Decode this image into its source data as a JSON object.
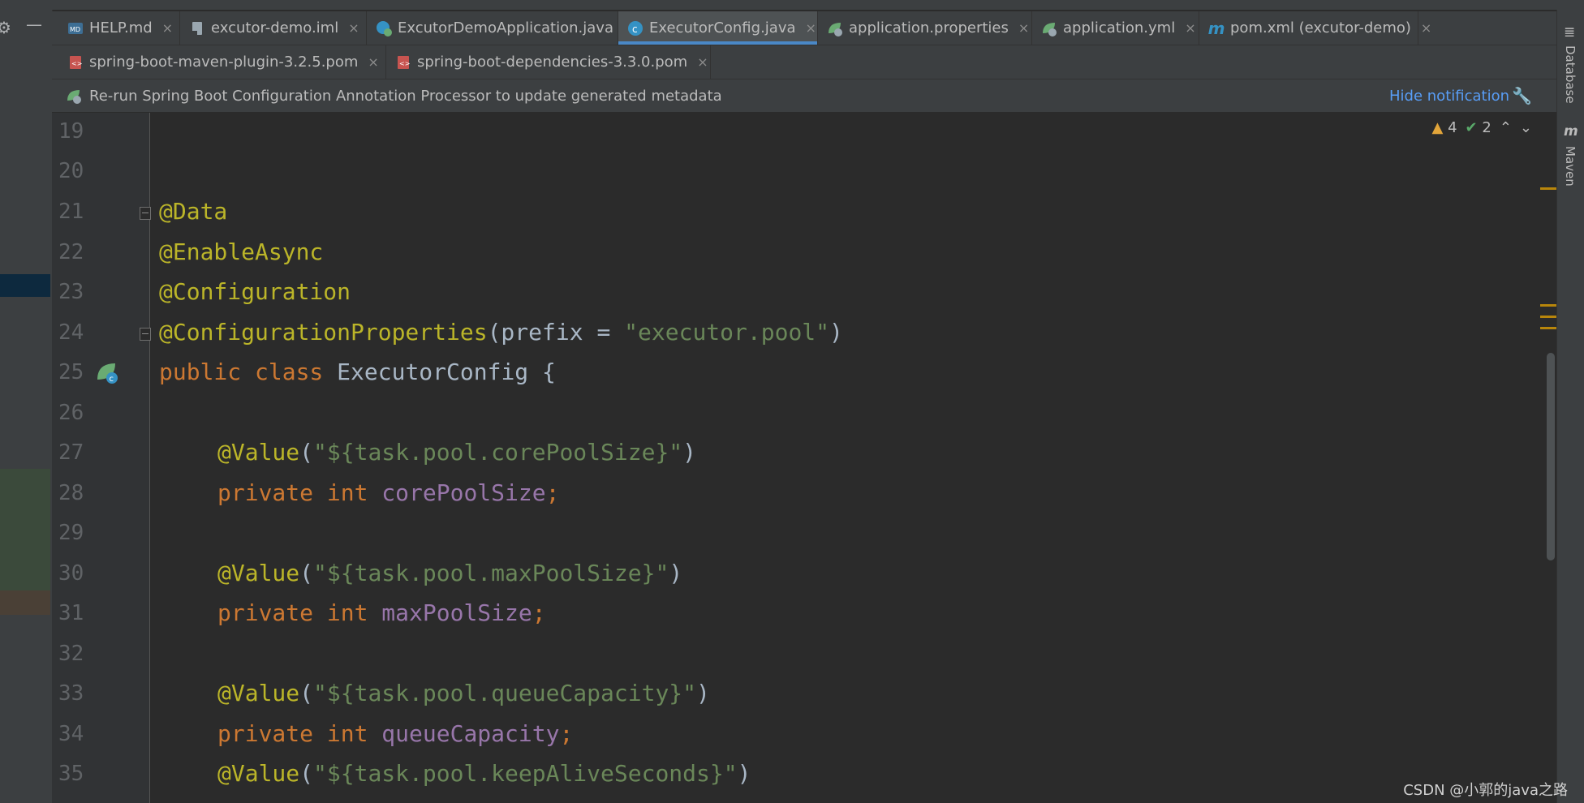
{
  "tabs_row1": [
    {
      "label": "HELP.md",
      "icon": "markdown-file-icon"
    },
    {
      "label": "excutor-demo.iml",
      "icon": "module-file-icon"
    },
    {
      "label": "ExcutorDemoApplication.java",
      "icon": "spring-boot-class-icon"
    },
    {
      "label": "ExecutorConfig.java",
      "icon": "java-class-icon",
      "active": true
    },
    {
      "label": "application.properties",
      "icon": "spring-properties-icon"
    },
    {
      "label": "application.yml",
      "icon": "spring-yaml-icon"
    },
    {
      "label": "pom.xml (excutor-demo)",
      "icon": "maven-icon"
    }
  ],
  "tabs_row2": [
    {
      "label": "spring-boot-maven-plugin-3.2.5.pom",
      "icon": "pom-file-icon"
    },
    {
      "label": "spring-boot-dependencies-3.3.0.pom",
      "icon": "pom-file-icon"
    }
  ],
  "tab_close_glyph": "×",
  "notification": {
    "text": "Re-run Spring Boot Configuration Annotation Processor to update generated metadata",
    "action": "Hide notification"
  },
  "inspection": {
    "warnings": "4",
    "weak_warnings": "2"
  },
  "right_toolbar": {
    "database": "Database",
    "maven": "Maven"
  },
  "line_numbers": [
    "19",
    "20",
    "21",
    "22",
    "23",
    "24",
    "25",
    "26",
    "27",
    "28",
    "29",
    "30",
    "31",
    "32",
    "33",
    "34",
    "35"
  ],
  "code": {
    "l21_ann": "@Data",
    "l22_ann": "@EnableAsync",
    "l23_ann": "@Configuration",
    "l24_ann": "@ConfigurationProperties",
    "l24_open": "(prefix = ",
    "l24_str": "\"executor.pool\"",
    "l24_close": ")",
    "l25_kw": "public class ",
    "l25_name": "ExecutorConfig {",
    "l27_ann": "@Value",
    "l27_open": "(",
    "l27_str": "\"${task.pool.corePoolSize}\"",
    "l27_close": ")",
    "l28_kw": "private int ",
    "l28_field": "corePoolSize",
    "l28_semi": ";",
    "l30_ann": "@Value",
    "l30_open": "(",
    "l30_str": "\"${task.pool.maxPoolSize}\"",
    "l30_close": ")",
    "l31_kw": "private int ",
    "l31_field": "maxPoolSize",
    "l31_semi": ";",
    "l33_ann": "@Value",
    "l33_open": "(",
    "l33_str": "\"${task.pool.queueCapacity}\"",
    "l33_close": ")",
    "l34_kw": "private int ",
    "l34_field": "queueCapacity",
    "l34_semi": ";",
    "l35_ann": "@Value",
    "l35_open": "(",
    "l35_str": "\"${task.pool.keepAliveSeconds}\"",
    "l35_close": ")"
  },
  "watermark": "CSDN @小郭的java之路"
}
